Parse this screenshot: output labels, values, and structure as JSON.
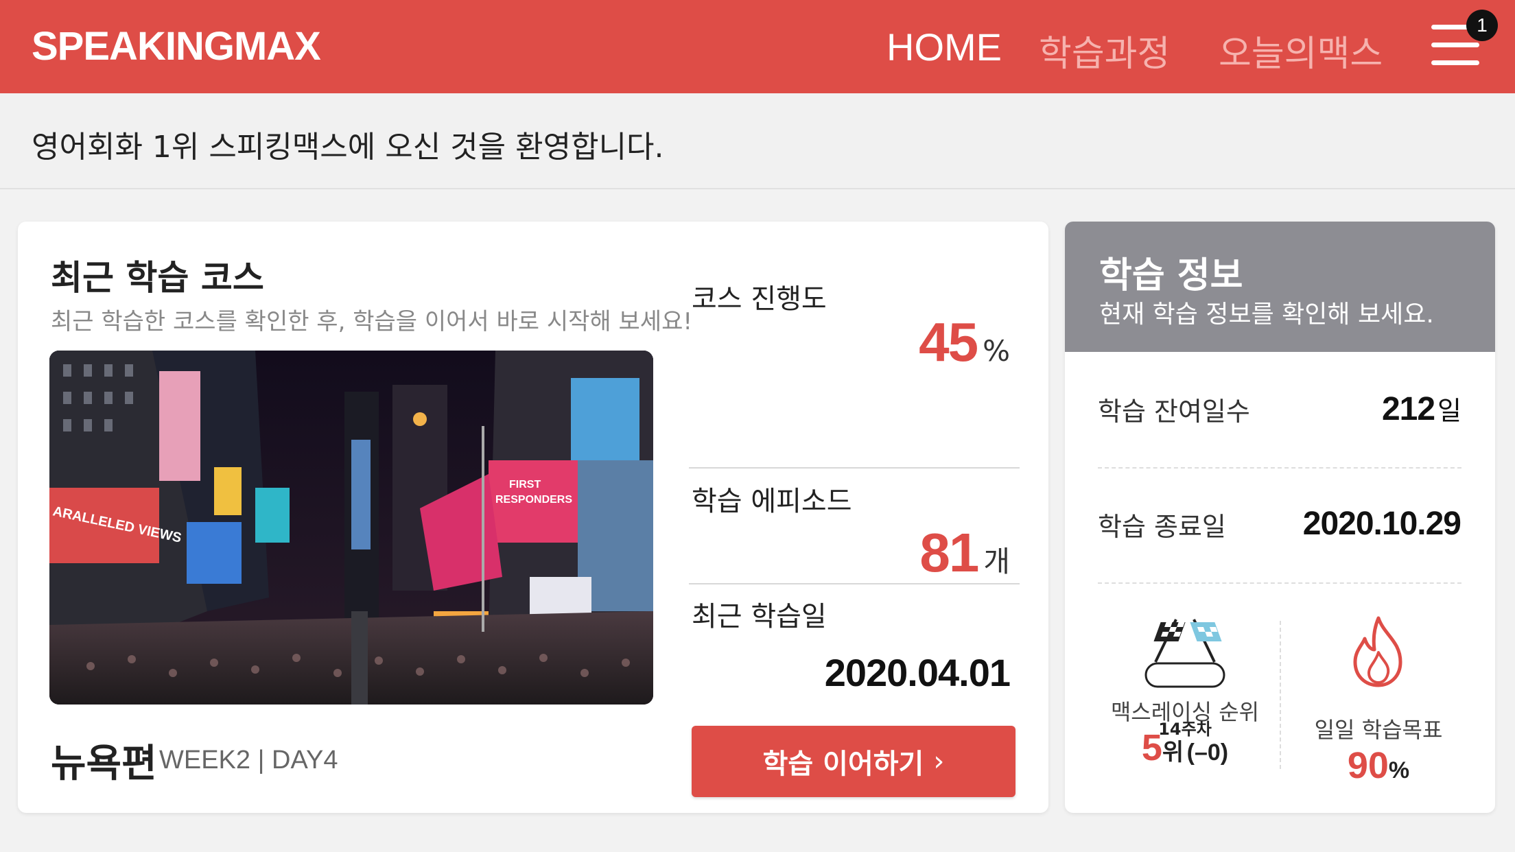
{
  "header": {
    "logo": "SPEAKINGMAX",
    "nav": [
      "HOME",
      "학습과정",
      "오늘의맥스"
    ],
    "menu_badge": "1",
    "brand_color": "#de4d47"
  },
  "welcome": "영어회화 1위 스피킹맥스에 오신 것을 환영합니다.",
  "recent": {
    "title": "최근 학습 코스",
    "subtitle": "최근 학습한 코스를 확인한 후, 학습을 이어서 바로 시작해 보세요!",
    "progress_label": "코스 진행도",
    "progress_value": "45",
    "progress_unit": "%",
    "episode_label": "학습 에피소드",
    "episode_value": "81",
    "episode_unit": "개",
    "last_label": "최근 학습일",
    "last_date": "2020.04.01",
    "course_name": "뉴욕편",
    "course_week": "WEEK2 | DAY4",
    "continue_label": "학습 이어하기",
    "photo_icon": "times-square-night-photo"
  },
  "info": {
    "title": "학습 정보",
    "subtitle": "현재 학습 정보를 확인해 보세요.",
    "remaining_label": "학습 잔여일수",
    "remaining_value": "212",
    "remaining_unit": "일",
    "end_label": "학습 종료일",
    "end_value": "2020.10.29",
    "race_badge": "14주차",
    "race_label": "맥스레이싱 순위",
    "race_rank": "5",
    "race_rank_unit": "위",
    "race_change": "(–0)",
    "goal_label": "일일 학습목표",
    "goal_value": "90",
    "goal_unit": "%"
  }
}
